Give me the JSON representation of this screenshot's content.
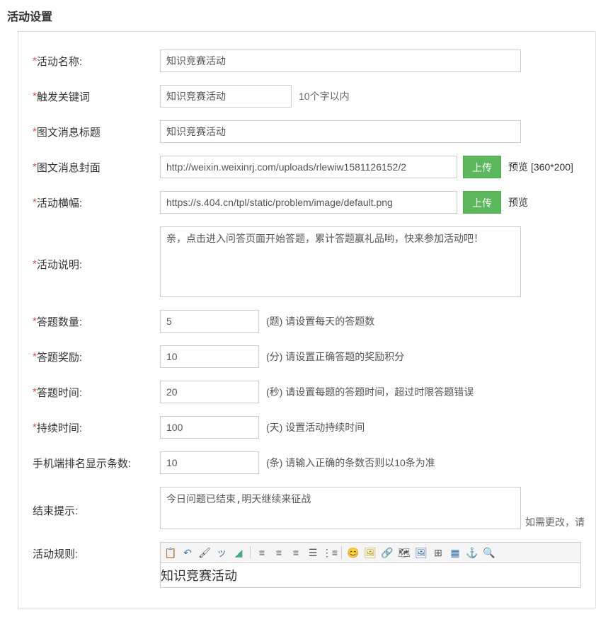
{
  "page_title": "活动设置",
  "fields": {
    "activity_name": {
      "label": "活动名称:",
      "value": "知识竞赛活动"
    },
    "trigger_keyword": {
      "label": "触发关键词",
      "value": "知识竞赛活动",
      "hint": "10个字以内"
    },
    "message_title": {
      "label": "图文消息标题",
      "value": "知识竞赛活动"
    },
    "message_cover": {
      "label": "图文消息封面",
      "value": "http://weixin.weixinrj.com/uploads/rlewiw1581126152/2",
      "upload": "上传",
      "preview": "预览",
      "size_hint": "[360*200]"
    },
    "banner": {
      "label": "活动横幅:",
      "value": "https://s.404.cn/tpl/static/problem/image/default.png",
      "upload": "上传",
      "preview": "预览"
    },
    "description": {
      "label": "活动说明:",
      "value": "亲，点击进入问答页面开始答题，累计答题赢礼品哟，快来参加活动吧！"
    },
    "question_count": {
      "label": "答题数量:",
      "value": "5",
      "hint": "(题) 请设置每天的答题数"
    },
    "reward": {
      "label": "答题奖励:",
      "value": "10",
      "hint": "(分) 请设置正确答题的奖励积分"
    },
    "answer_time": {
      "label": "答题时间:",
      "value": "20",
      "hint": "(秒) 请设置每题的答题时间，超过时限答题错误"
    },
    "duration": {
      "label": "持续时间:",
      "value": "100",
      "hint": "(天) 设置活动持续时间"
    },
    "mobile_rank": {
      "label": "手机端排名显示条数:",
      "value": "10",
      "hint": "(条) 请输入正确的条数否则以10条为准"
    },
    "end_prompt": {
      "label": "结束提示:",
      "value": "今日问题已结束,明天继续来征战",
      "change_hint": "如需更改，请"
    },
    "rules": {
      "label": "活动规则:",
      "content": "知识竞赛活动"
    }
  }
}
